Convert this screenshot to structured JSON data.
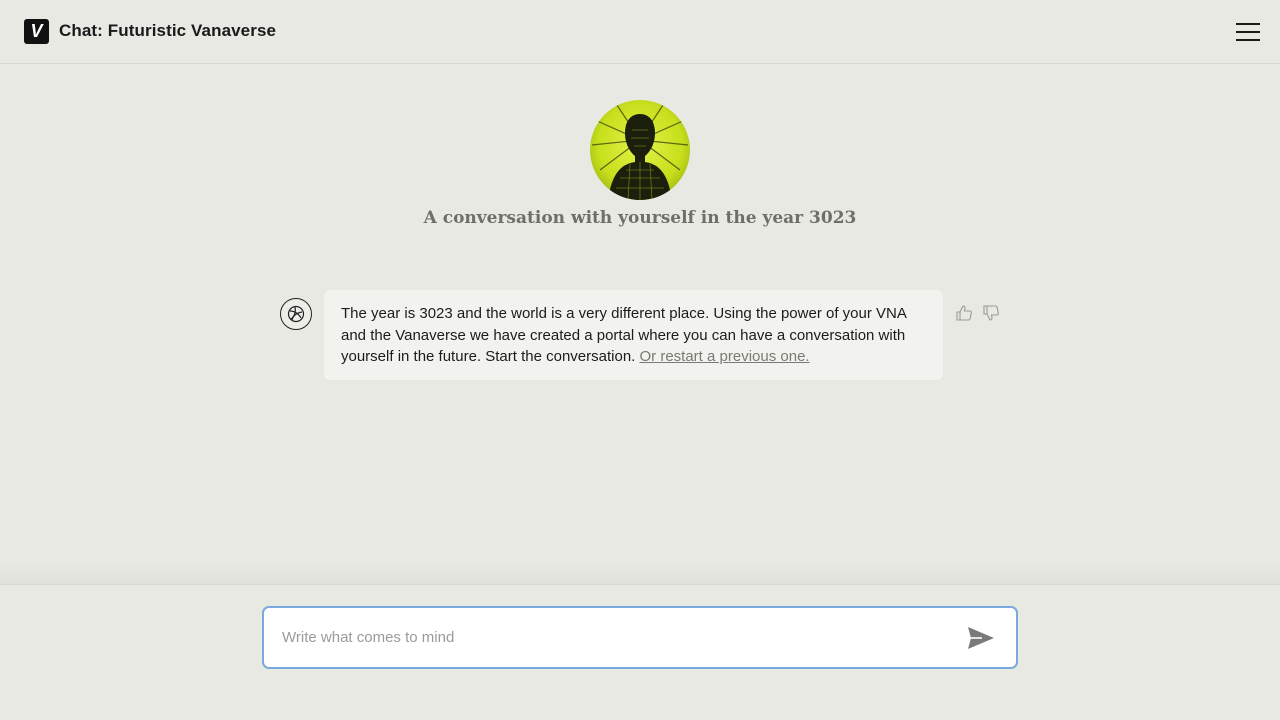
{
  "header": {
    "title": "Chat: Futuristic Vanaverse",
    "logo_letter": "V",
    "menu_icon": "hamburger-menu-icon"
  },
  "intro": {
    "subtitle": "A conversation with yourself in the year 3023"
  },
  "messages": [
    {
      "author_icon": "bot-avatar-icon",
      "text": "The year is 3023 and the world is a very different place. Using the power of your VNA and the Vanaverse we have created a portal where you can have a conversation with yourself in the future. Start the conversation. ",
      "link_text": "Or restart a previous one."
    }
  ],
  "composer": {
    "placeholder": "Write what comes to mind",
    "value": "",
    "send_icon": "send-icon"
  },
  "colors": {
    "background": "#e9e9e4",
    "accent_border": "#7aa9de",
    "avatar_lime": "#c8e01c"
  }
}
